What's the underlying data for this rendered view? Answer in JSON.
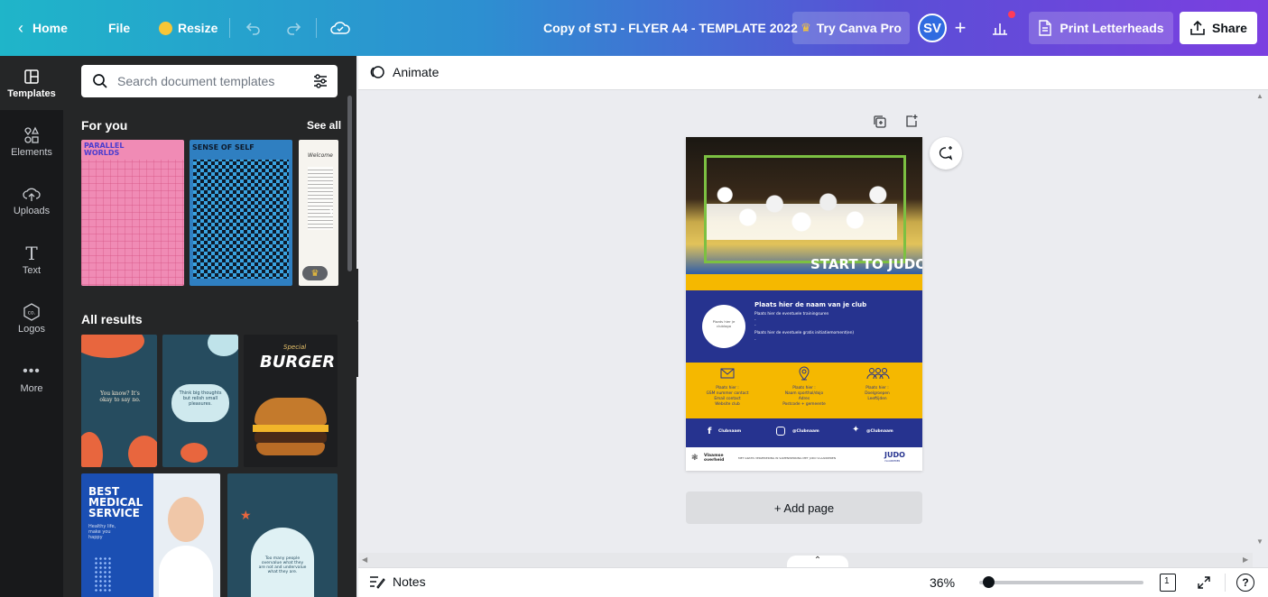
{
  "topbar": {
    "home_label": "Home",
    "file_label": "File",
    "resize_label": "Resize",
    "doc_title": "Copy of STJ - FLYER A4 - TEMPLATE 2022",
    "try_pro_label": "Try Canva Pro",
    "avatar_initials": "SV",
    "print_label": "Print Letterheads",
    "share_label": "Share"
  },
  "rail": {
    "items": [
      {
        "label": "Templates",
        "icon": "templates-icon"
      },
      {
        "label": "Elements",
        "icon": "elements-icon"
      },
      {
        "label": "Uploads",
        "icon": "uploads-icon"
      },
      {
        "label": "Text",
        "icon": "text-icon"
      },
      {
        "label": "Logos",
        "icon": "logos-icon"
      },
      {
        "label": "More",
        "icon": "more-icon"
      }
    ]
  },
  "panel": {
    "search_placeholder": "Search document templates",
    "for_you_title": "For you",
    "see_all_label": "See all",
    "all_results_title": "All results",
    "thumbs": {
      "t1_title": "PARALLEL WORLDS",
      "t2_title": "SENSE OF SELF",
      "t3_title": "Welcome",
      "r1_text": "You know? It's okay to say no.",
      "r2_text": "Think big thoughts but relish small pleasures.",
      "r3_small": "Special",
      "r3_title": "BURGER",
      "r4_title": "BEST MEDICAL SERVICE",
      "r4_sub": "Healthy life, make you happy",
      "r5_text": "Too many people overvalue what they are not and undervalue what they are."
    }
  },
  "subbar": {
    "animate_label": "Animate"
  },
  "flyer": {
    "headline": "START TO JUDO",
    "logo_placeholder": "Plaats hier je clublogo",
    "club_name": "Plaats hier de naam van je club",
    "trainings": "Plaats hier de eventuele trainingsuren",
    "dash1": "-",
    "dash2": "-",
    "initiation": "Plaats hier de eventuele gratis initiatiemoment(en)",
    "dash3": "-",
    "col1": [
      "Plaats hier :",
      "GSM nummer contact",
      "Email contact",
      "Website club"
    ],
    "col2": [
      "Plaats hier :",
      "Naam sporthal/dojo",
      "Adres",
      "Postcode + gemeente"
    ],
    "col3": [
      "Plaats hier :",
      "Doelgroepen",
      "Leeftijden"
    ],
    "social": [
      "Clubnaam",
      "@Clubnaam",
      "@Clubnaam"
    ],
    "footer_gov": "Vlaamse overheid",
    "footer_text": "MET GRATIS VERZEKERING IN SAMENWERKING MET JUDO VLAANDEREN",
    "footer_logo": "JUDO",
    "footer_logo_sub": "VLAANDEREN"
  },
  "canvas": {
    "add_page_label": "+ Add page"
  },
  "bottombar": {
    "notes_label": "Notes",
    "zoom": "36%",
    "page_count": "1"
  },
  "colors": {
    "accent_pink": "#f08bb5",
    "navy": "#26338f",
    "yellow": "#f5b800",
    "green_frame": "#7cc042"
  }
}
